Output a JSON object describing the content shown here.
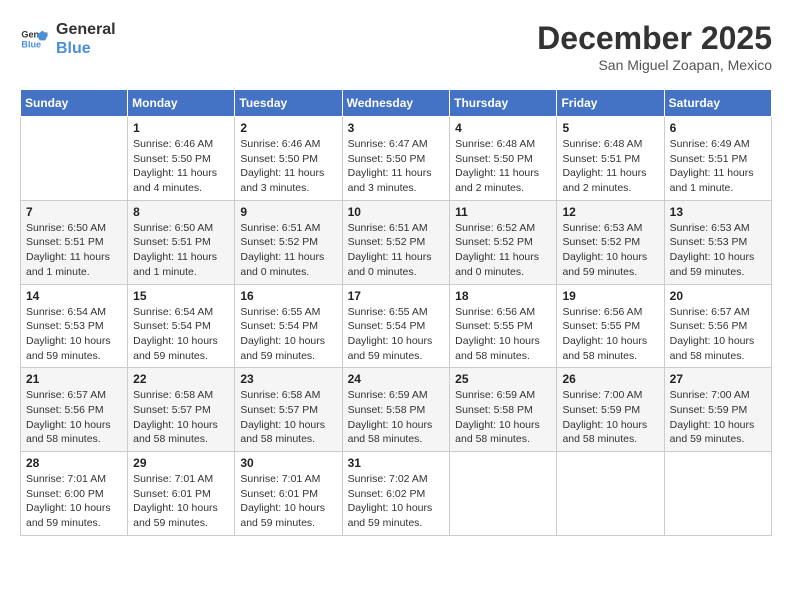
{
  "header": {
    "logo_line1": "General",
    "logo_line2": "Blue",
    "month": "December 2025",
    "location": "San Miguel Zoapan, Mexico"
  },
  "weekdays": [
    "Sunday",
    "Monday",
    "Tuesday",
    "Wednesday",
    "Thursday",
    "Friday",
    "Saturday"
  ],
  "weeks": [
    [
      {
        "day": "",
        "detail": ""
      },
      {
        "day": "1",
        "detail": "Sunrise: 6:46 AM\nSunset: 5:50 PM\nDaylight: 11 hours\nand 4 minutes."
      },
      {
        "day": "2",
        "detail": "Sunrise: 6:46 AM\nSunset: 5:50 PM\nDaylight: 11 hours\nand 3 minutes."
      },
      {
        "day": "3",
        "detail": "Sunrise: 6:47 AM\nSunset: 5:50 PM\nDaylight: 11 hours\nand 3 minutes."
      },
      {
        "day": "4",
        "detail": "Sunrise: 6:48 AM\nSunset: 5:50 PM\nDaylight: 11 hours\nand 2 minutes."
      },
      {
        "day": "5",
        "detail": "Sunrise: 6:48 AM\nSunset: 5:51 PM\nDaylight: 11 hours\nand 2 minutes."
      },
      {
        "day": "6",
        "detail": "Sunrise: 6:49 AM\nSunset: 5:51 PM\nDaylight: 11 hours\nand 1 minute."
      }
    ],
    [
      {
        "day": "7",
        "detail": "Sunrise: 6:50 AM\nSunset: 5:51 PM\nDaylight: 11 hours\nand 1 minute."
      },
      {
        "day": "8",
        "detail": "Sunrise: 6:50 AM\nSunset: 5:51 PM\nDaylight: 11 hours\nand 1 minute."
      },
      {
        "day": "9",
        "detail": "Sunrise: 6:51 AM\nSunset: 5:52 PM\nDaylight: 11 hours\nand 0 minutes."
      },
      {
        "day": "10",
        "detail": "Sunrise: 6:51 AM\nSunset: 5:52 PM\nDaylight: 11 hours\nand 0 minutes."
      },
      {
        "day": "11",
        "detail": "Sunrise: 6:52 AM\nSunset: 5:52 PM\nDaylight: 11 hours\nand 0 minutes."
      },
      {
        "day": "12",
        "detail": "Sunrise: 6:53 AM\nSunset: 5:52 PM\nDaylight: 10 hours\nand 59 minutes."
      },
      {
        "day": "13",
        "detail": "Sunrise: 6:53 AM\nSunset: 5:53 PM\nDaylight: 10 hours\nand 59 minutes."
      }
    ],
    [
      {
        "day": "14",
        "detail": "Sunrise: 6:54 AM\nSunset: 5:53 PM\nDaylight: 10 hours\nand 59 minutes."
      },
      {
        "day": "15",
        "detail": "Sunrise: 6:54 AM\nSunset: 5:54 PM\nDaylight: 10 hours\nand 59 minutes."
      },
      {
        "day": "16",
        "detail": "Sunrise: 6:55 AM\nSunset: 5:54 PM\nDaylight: 10 hours\nand 59 minutes."
      },
      {
        "day": "17",
        "detail": "Sunrise: 6:55 AM\nSunset: 5:54 PM\nDaylight: 10 hours\nand 59 minutes."
      },
      {
        "day": "18",
        "detail": "Sunrise: 6:56 AM\nSunset: 5:55 PM\nDaylight: 10 hours\nand 58 minutes."
      },
      {
        "day": "19",
        "detail": "Sunrise: 6:56 AM\nSunset: 5:55 PM\nDaylight: 10 hours\nand 58 minutes."
      },
      {
        "day": "20",
        "detail": "Sunrise: 6:57 AM\nSunset: 5:56 PM\nDaylight: 10 hours\nand 58 minutes."
      }
    ],
    [
      {
        "day": "21",
        "detail": "Sunrise: 6:57 AM\nSunset: 5:56 PM\nDaylight: 10 hours\nand 58 minutes."
      },
      {
        "day": "22",
        "detail": "Sunrise: 6:58 AM\nSunset: 5:57 PM\nDaylight: 10 hours\nand 58 minutes."
      },
      {
        "day": "23",
        "detail": "Sunrise: 6:58 AM\nSunset: 5:57 PM\nDaylight: 10 hours\nand 58 minutes."
      },
      {
        "day": "24",
        "detail": "Sunrise: 6:59 AM\nSunset: 5:58 PM\nDaylight: 10 hours\nand 58 minutes."
      },
      {
        "day": "25",
        "detail": "Sunrise: 6:59 AM\nSunset: 5:58 PM\nDaylight: 10 hours\nand 58 minutes."
      },
      {
        "day": "26",
        "detail": "Sunrise: 7:00 AM\nSunset: 5:59 PM\nDaylight: 10 hours\nand 58 minutes."
      },
      {
        "day": "27",
        "detail": "Sunrise: 7:00 AM\nSunset: 5:59 PM\nDaylight: 10 hours\nand 59 minutes."
      }
    ],
    [
      {
        "day": "28",
        "detail": "Sunrise: 7:01 AM\nSunset: 6:00 PM\nDaylight: 10 hours\nand 59 minutes."
      },
      {
        "day": "29",
        "detail": "Sunrise: 7:01 AM\nSunset: 6:01 PM\nDaylight: 10 hours\nand 59 minutes."
      },
      {
        "day": "30",
        "detail": "Sunrise: 7:01 AM\nSunset: 6:01 PM\nDaylight: 10 hours\nand 59 minutes."
      },
      {
        "day": "31",
        "detail": "Sunrise: 7:02 AM\nSunset: 6:02 PM\nDaylight: 10 hours\nand 59 minutes."
      },
      {
        "day": "",
        "detail": ""
      },
      {
        "day": "",
        "detail": ""
      },
      {
        "day": "",
        "detail": ""
      }
    ]
  ]
}
